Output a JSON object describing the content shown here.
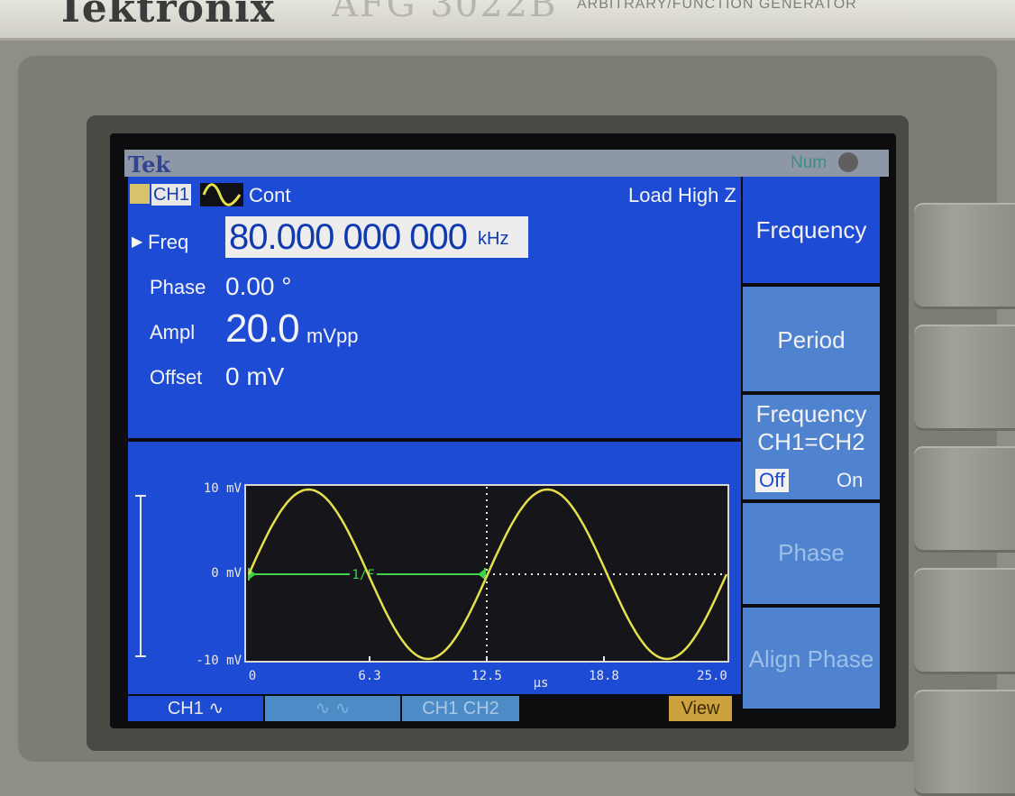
{
  "bezel": {
    "brand": "Tektronix",
    "model": "AFG 3022B",
    "model_sub": "ARBITRARY/FUNCTION GENERATOR"
  },
  "screen": {
    "logo": "Tek",
    "num_indicator": "Num"
  },
  "channel": {
    "label": "CH1",
    "waveform_icon": "sine-icon",
    "mode": "Cont",
    "load": "Load High Z"
  },
  "params": {
    "freq_label": "Freq",
    "freq_value": "80.000 000 000",
    "freq_unit": "kHz",
    "phase_label": "Phase",
    "phase_value": "0.00 °",
    "ampl_label": "Ampl",
    "ampl_value": "20.0",
    "ampl_unit": "mVpp",
    "offset_label": "Offset",
    "offset_value": "0 mV"
  },
  "plot": {
    "y_labels": [
      "10 mV",
      "0 mV",
      "-10 mV"
    ],
    "x_labels": [
      "0",
      "6.3",
      "12.5",
      "18.8",
      "25.0"
    ],
    "x_unit": "µs",
    "period_marker": "1/F",
    "trace_color": "#e6e14a",
    "marker_color": "#3fd24a"
  },
  "tabs": {
    "ch1": "CH1",
    "ch1_ch2": "CH1  CH2",
    "view": "View"
  },
  "menu": {
    "frequency": "Frequency",
    "period": "Period",
    "freq_link_line1": "Frequency",
    "freq_link_line2": "CH1=CH2",
    "off": "Off",
    "on": "On",
    "phase": "Phase",
    "align_phase": "Align Phase"
  },
  "colors": {
    "screen_blue": "#1e4bd4",
    "menu_blue": "#4f82cf"
  }
}
